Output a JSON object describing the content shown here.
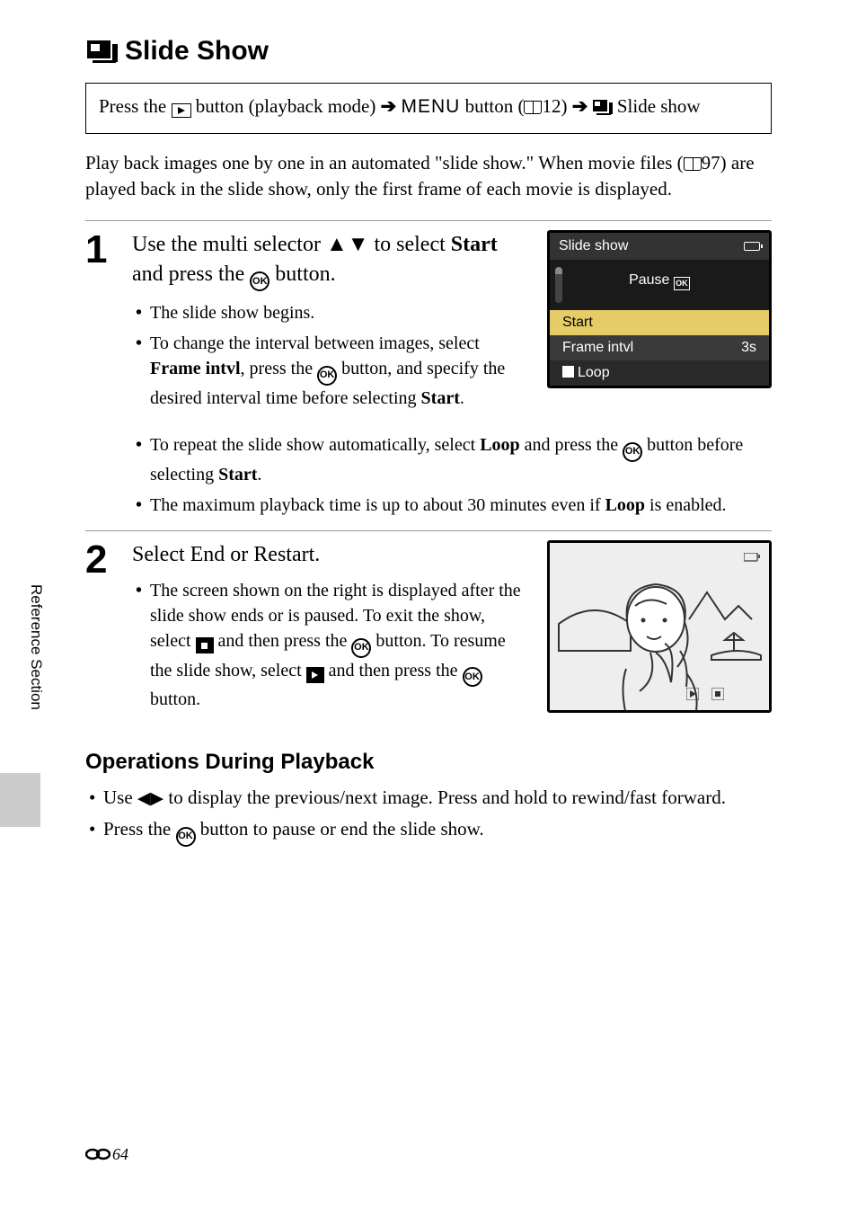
{
  "title": "Slide Show",
  "breadcrumb": {
    "t1": "Press the ",
    "t2": " button (playback mode) ",
    "t3_menu": "MENU",
    "t4": " button (",
    "t5_page": "12",
    "t6": ") ",
    "t7": " Slide show"
  },
  "intro": {
    "t1": "Play back images one by one in an automated \"slide show.\" When movie files (",
    "t2_page": "97",
    "t3": ") are played back in the slide show, only the first frame of each movie is displayed."
  },
  "step1": {
    "num": "1",
    "head_t1": "Use the multi selector ",
    "head_t2": " to select ",
    "head_start": "Start",
    "head_t3": " and press the ",
    "head_t4": " button.",
    "b1": "The slide show begins.",
    "b2_t1": "To change the interval between images, select ",
    "b2_fi": "Frame intvl",
    "b2_t2": ", press the ",
    "b2_t3": " button, and specify the desired interval time before selecting ",
    "b2_start": "Start",
    "b2_t4": ".",
    "b3_t1": "To repeat the slide show automatically, select ",
    "b3_loop": "Loop",
    "b3_t2": " and press the ",
    "b3_t3": " button before selecting ",
    "b3_start": "Start",
    "b3_t4": ".",
    "b4_t1": "The maximum playback time is up to about 30 minutes even if ",
    "b4_loop": "Loop",
    "b4_t2": " is enabled."
  },
  "screen1": {
    "title": "Slide show",
    "pause": "Pause",
    "start": "Start",
    "frame": "Frame intvl",
    "frame_val": "3s",
    "loop": "Loop"
  },
  "step2": {
    "num": "2",
    "head": "Select End or Restart.",
    "b1_t1": "The screen shown on the right is displayed after the slide show ends or is paused. To exit the show, select ",
    "b1_t2": " and then press the ",
    "b1_t3": " button. To resume the slide show, select ",
    "b1_t4": " and then press the ",
    "b1_t5": " button."
  },
  "ops": {
    "title": "Operations During Playback",
    "b1_t1": "Use ",
    "b1_t2": " to display the previous/next image. Press and hold to rewind/fast forward.",
    "b2_t1": "Press the ",
    "b2_t2": " button to pause or end the slide show."
  },
  "page_num": "64"
}
